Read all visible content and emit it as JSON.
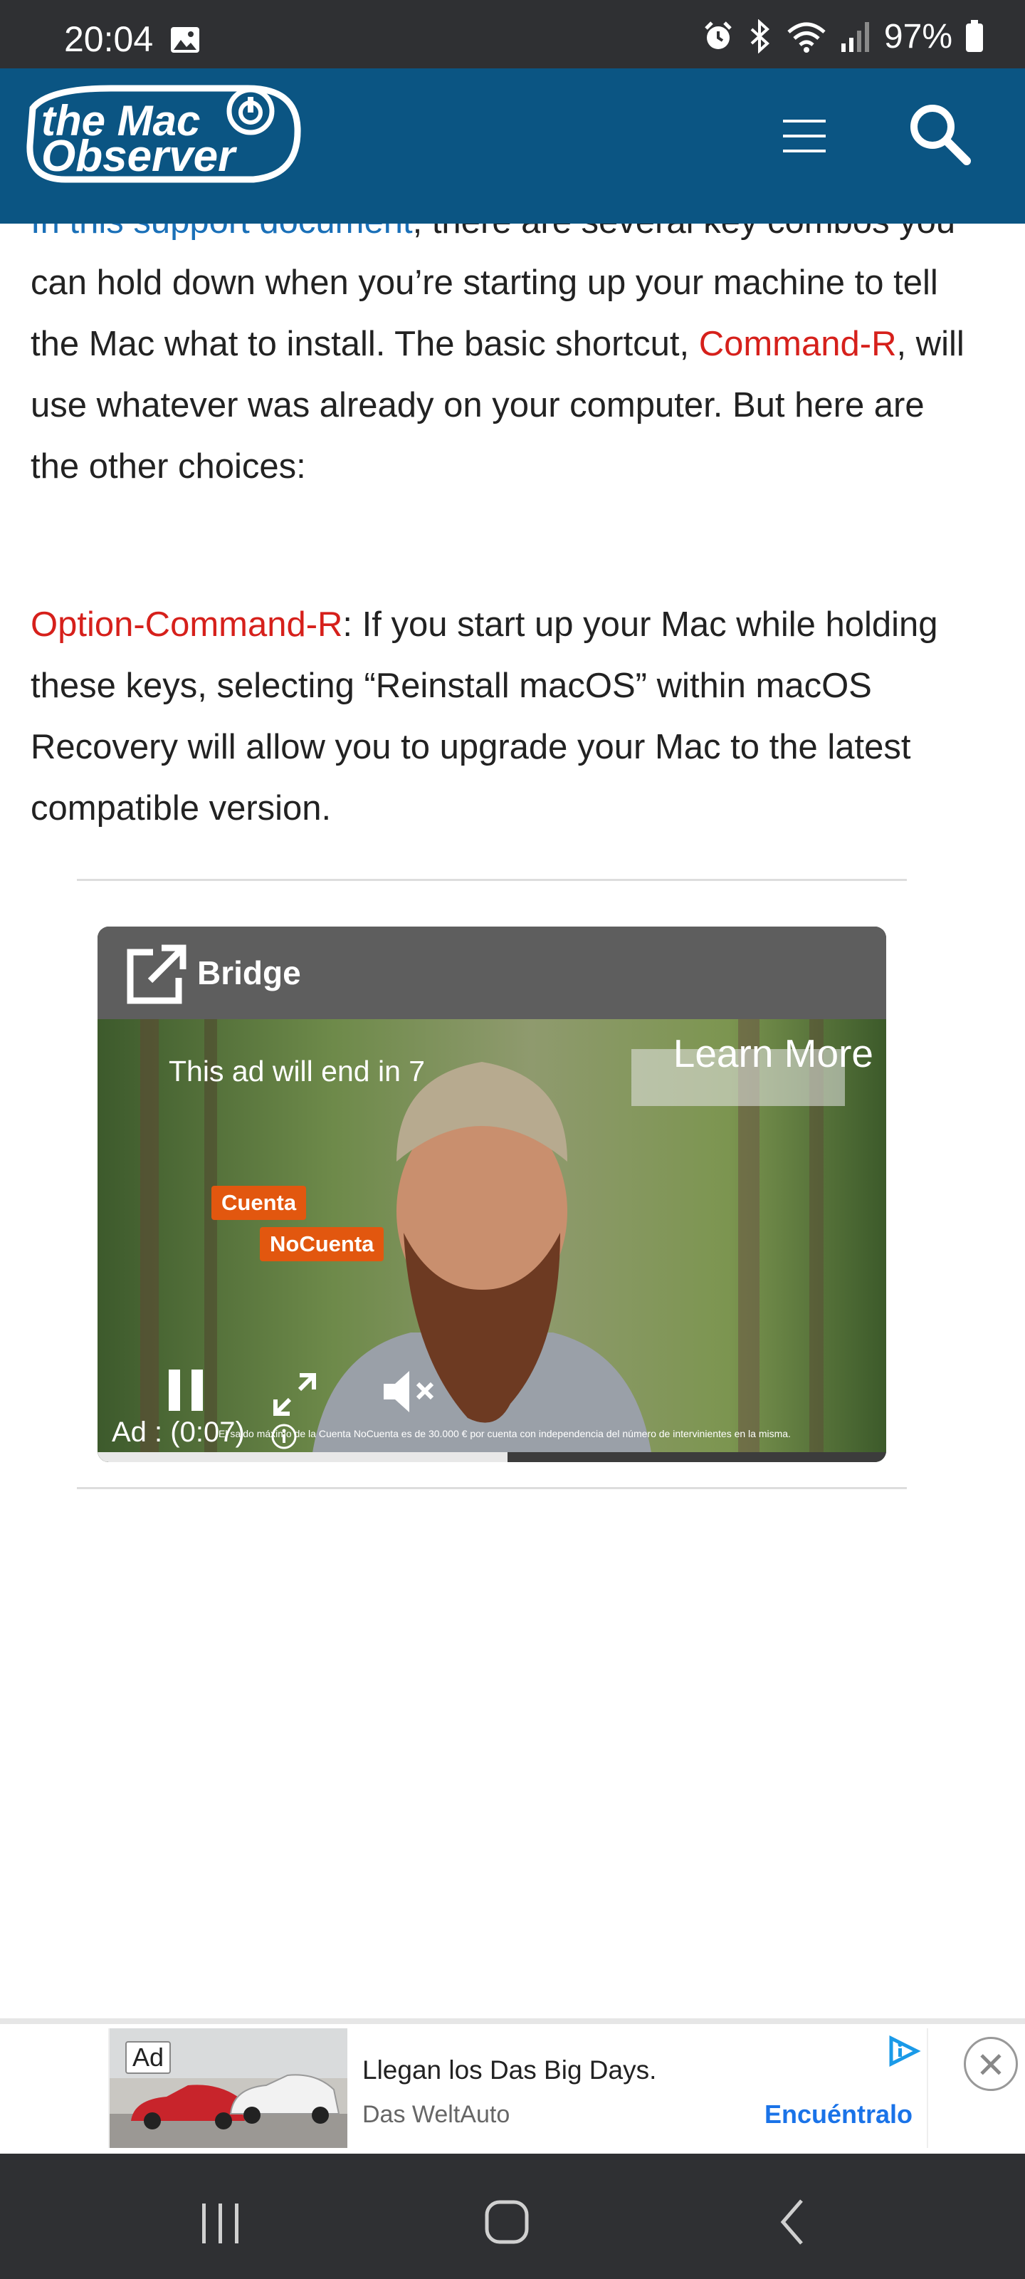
{
  "status_bar": {
    "time": "20:04",
    "battery": "97%"
  },
  "header": {
    "logo_line1": "the Mac",
    "logo_line2": "Observer"
  },
  "article": {
    "p1_link": "In this support document",
    "p1_after_link": ", there are several key combos you can hold down when you’re starting up your machine to tell the Mac what to install. The basic shortcut, ",
    "p1_shortcut": "Command-R",
    "p1_rest": ", will use whatever was already on your computer. But here are the other choices:",
    "p2_shortcut": "Option-Command-R",
    "p2_rest": ": If you start up your Mac while holding these keys, selecting “Reinstall macOS” within macOS Recovery will allow you to upgrade your Mac to the latest compatible version."
  },
  "video_ad": {
    "title": "Bridge",
    "end_text": "This ad will end in 7",
    "learn_more": "Learn More",
    "chip1": "Cuenta",
    "chip2": "NoCuenta",
    "countdown": "Ad : (0:07)",
    "disclaimer": "El saldo máximo de la Cuenta NoCuenta es de 30.000 € por cuenta con independencia del número de intervinientes en la misma.",
    "progress": 0.52
  },
  "bottom_ad": {
    "label": "Ad",
    "headline": "Llegan los Das Big Days.",
    "advertiser": "Das WeltAuto",
    "cta": "Encuéntralo",
    "close": "✕"
  },
  "colors": {
    "header_bg": "#0b5583",
    "link": "#1a70b8",
    "shortcut": "#d6201b",
    "cta": "#1a73e8",
    "chip": "#e2570f"
  },
  "icons": [
    "image-icon",
    "alarm-icon",
    "bluetooth-icon",
    "wifi-icon",
    "signal-icon",
    "battery-icon",
    "menu-icon",
    "search-icon",
    "external-link-icon",
    "pause-icon",
    "fullscreen-icon",
    "mute-icon",
    "info-icon",
    "adchoices-icon",
    "close-icon",
    "recents-icon",
    "home-icon",
    "back-icon"
  ]
}
